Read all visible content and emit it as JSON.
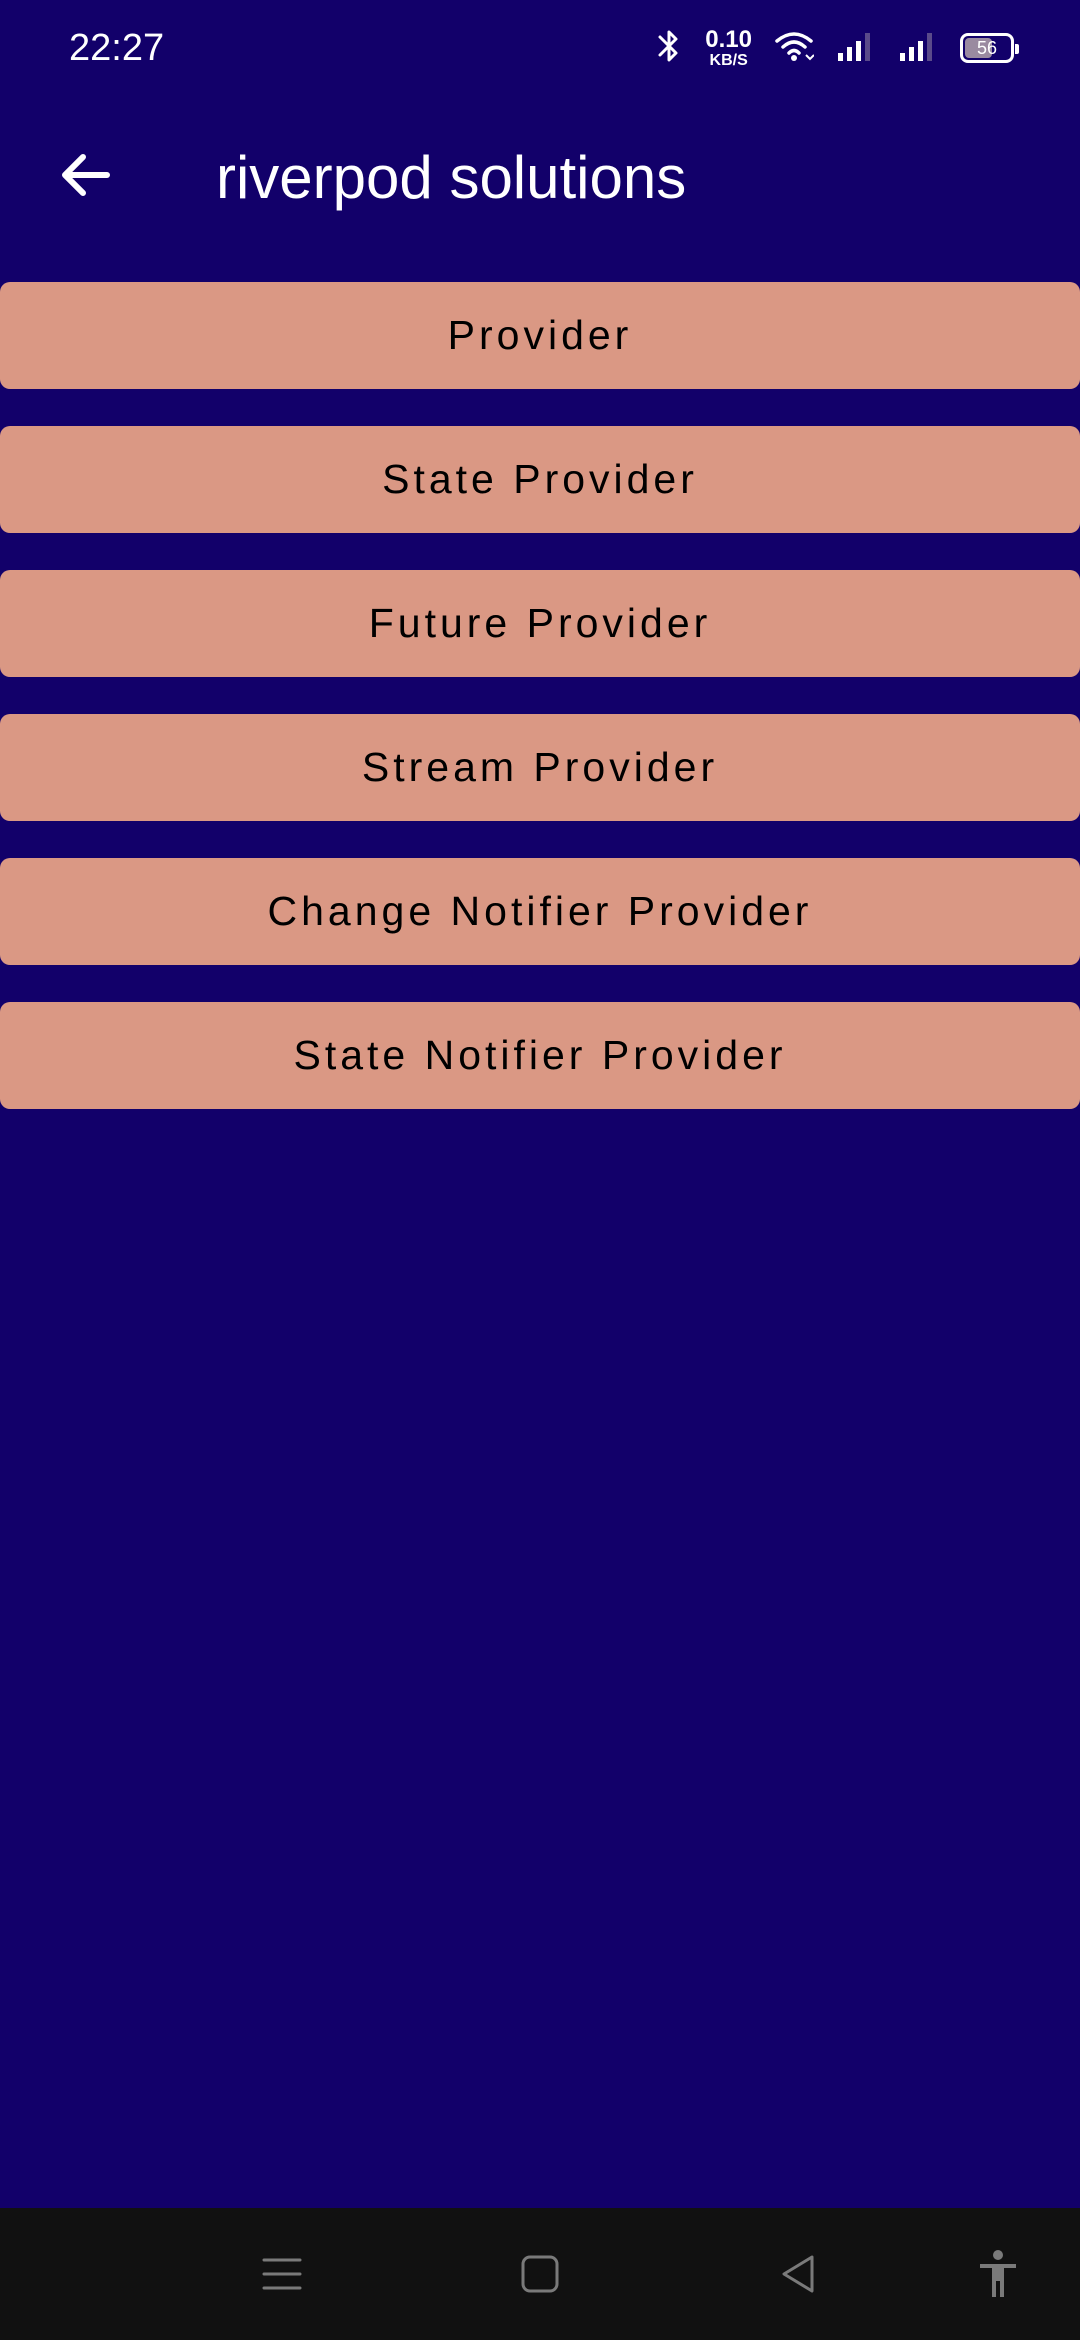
{
  "status_bar": {
    "time": "22:27",
    "net_speed_value": "0.10",
    "net_speed_unit": "KB/S",
    "battery_level": "56",
    "icons": [
      "bluetooth-icon",
      "wifi-icon",
      "signal-icon",
      "signal-icon",
      "battery-icon"
    ]
  },
  "app_bar": {
    "title": "riverpod solutions",
    "back_icon": "arrow-left-icon"
  },
  "buttons": [
    {
      "label": "Provider"
    },
    {
      "label": "State Provider"
    },
    {
      "label": "Future Provider"
    },
    {
      "label": "Stream Provider"
    },
    {
      "label": "Change Notifier Provider"
    },
    {
      "label": "State Notifier Provider"
    }
  ],
  "nav_bar": {
    "icons": [
      "menu-icon",
      "home-icon",
      "back-icon",
      "accessibility-icon"
    ]
  },
  "colors": {
    "background": "#12006a",
    "button": "#da9884",
    "nav_bar": "#111111"
  }
}
